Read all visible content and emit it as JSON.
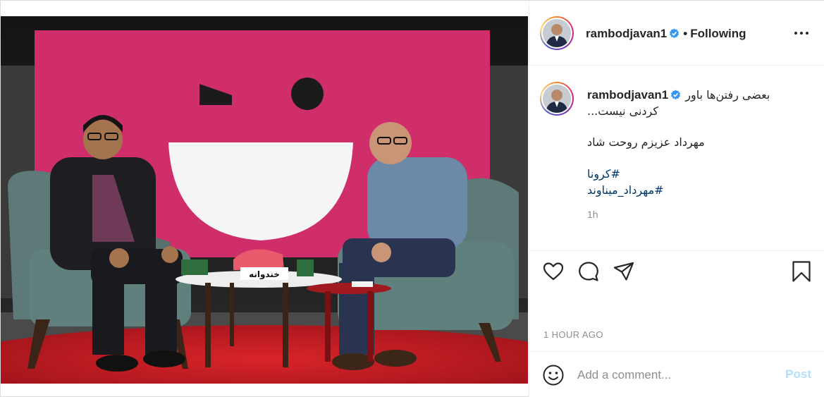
{
  "post": {
    "author": {
      "username": "rambodjavan1",
      "verified": true,
      "follow_status": "Following"
    },
    "media": {
      "logo_text": "خندوانه"
    },
    "caption": {
      "username": "rambodjavan1",
      "line1": "بعضی رفتن‌ها باور",
      "line2": "...کردنی نیست",
      "line3": "مهرداد عزیزم روحت شاد",
      "hashtags": [
        "کرونا#",
        "مهرداد_میناوند#"
      ],
      "relative_time": "1h"
    },
    "timestamp": "1 HOUR AGO",
    "comment": {
      "placeholder": "Add a comment...",
      "post_label": "Post"
    },
    "separator": "•"
  },
  "colors": {
    "verified_badge": "#3897f0",
    "hashtag": "#00376b",
    "post_button_disabled": "#b2dffc",
    "screen_magenta": "#cf2e6a",
    "stage_red": "#b3151e"
  },
  "icons": {
    "more": "more-horizontal-icon",
    "like": "heart-icon",
    "comment": "speech-bubble-icon",
    "share": "paper-plane-icon",
    "save": "bookmark-icon",
    "emoji": "smiley-icon",
    "verified": "verified-badge-icon"
  }
}
